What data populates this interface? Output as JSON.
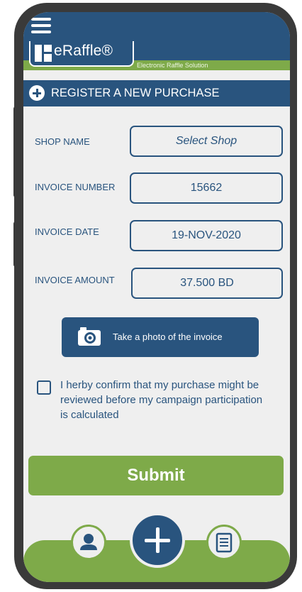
{
  "app": {
    "logo_text": "eRaffle®",
    "tagline": "Electronic Raffle Solution"
  },
  "section": {
    "title": "REGISTER A NEW PURCHASE"
  },
  "form": {
    "shop_label": "SHOP NAME",
    "shop_placeholder": "Select Shop",
    "invoice_number_label": "INVOICE NUMBER",
    "invoice_number_value": "15662",
    "invoice_date_label": "INVOICE DATE",
    "invoice_date_value": "19-NOV-2020",
    "invoice_amount_label": "INVOICE AMOUNT",
    "invoice_amount_value": "37.500 BD",
    "photo_button_label": "Take a photo of the invoice",
    "confirm_text": "I herby confirm that my purchase might be reviewed before my campaign participation is calculated",
    "submit_label": "Submit"
  },
  "colors": {
    "primary": "#29547e",
    "accent": "#7eaa49",
    "background": "#efefef"
  },
  "icons": [
    "menu-icon",
    "plus-icon",
    "camera-icon",
    "user-icon",
    "add-icon",
    "receipt-icon"
  ]
}
